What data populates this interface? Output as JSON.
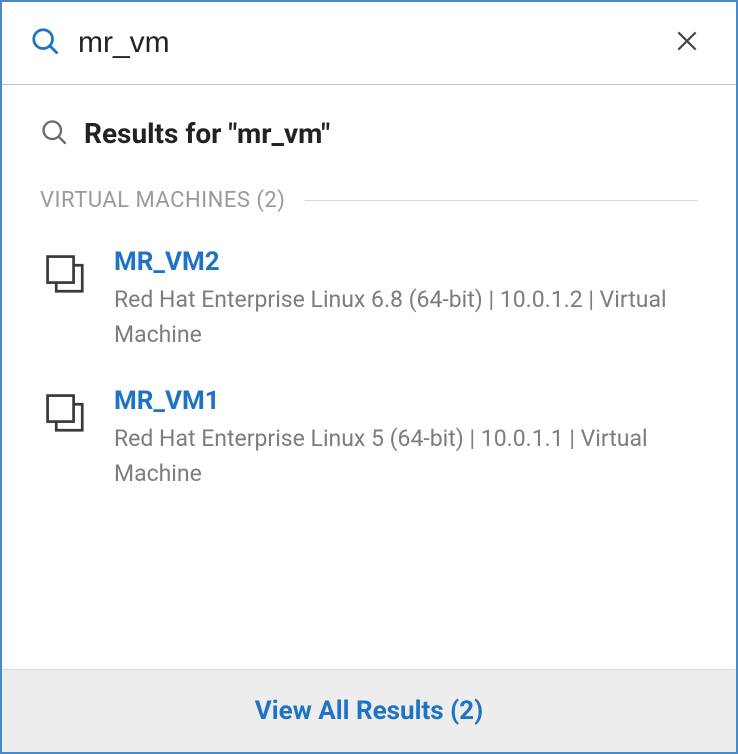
{
  "search": {
    "value": "mr_vm",
    "placeholder": ""
  },
  "results_header": "Results for \"mr_vm\"",
  "section": {
    "label": "VIRTUAL MACHINES (2)"
  },
  "results": [
    {
      "title": "MR_VM2",
      "subtitle": "Red Hat Enterprise Linux 6.8 (64-bit) | 10.0.1.2 | Virtual Machine"
    },
    {
      "title": "MR_VM1",
      "subtitle": "Red Hat Enterprise Linux 5 (64-bit) | 10.0.1.1 | Virtual Machine"
    }
  ],
  "footer": {
    "view_all_label": "View All Results (2)"
  }
}
